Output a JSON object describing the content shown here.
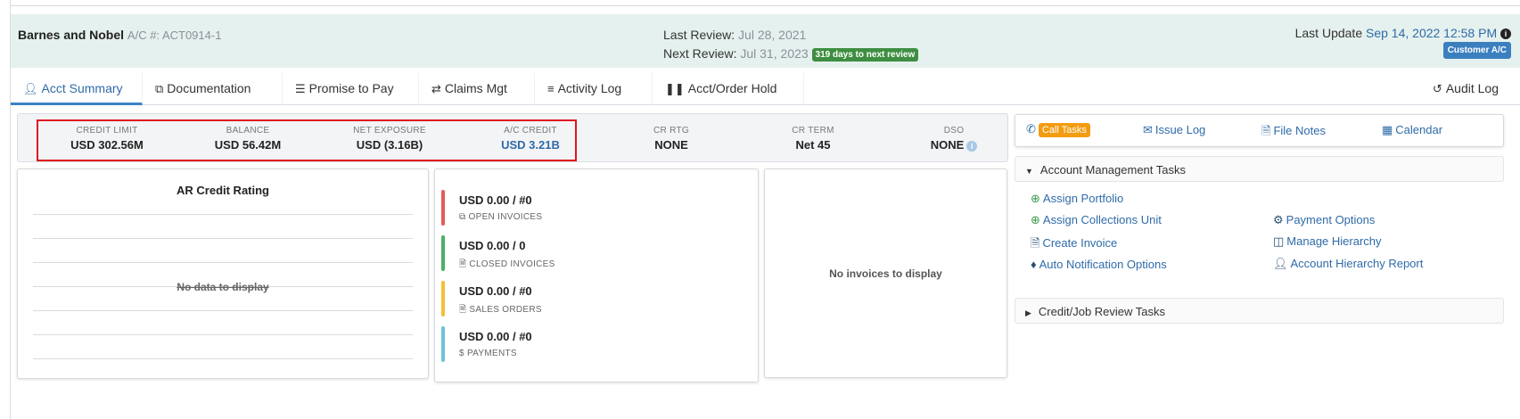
{
  "header": {
    "account_name": "Barnes and Nobel",
    "account_meta": "A/C #: ACT0914-1",
    "last_review_label": "Last Review:",
    "last_review_value": "Jul 28, 2021",
    "next_review_label": "Next Review:",
    "next_review_value": "Jul 31, 2023",
    "days_badge": "319 days to next review",
    "last_update_label": "Last Update",
    "last_update_value": "Sep 14, 2022 12:58 PM",
    "customer_badge": "Customer A/C"
  },
  "tabs": [
    {
      "label": "Acct Summary",
      "icon": "user-icon",
      "active": true
    },
    {
      "label": "Documentation",
      "icon": "copy-icon",
      "active": false
    },
    {
      "label": "Promise to Pay",
      "icon": "list-icon",
      "active": false
    },
    {
      "label": "Claims Mgt",
      "icon": "shuffle-icon",
      "active": false
    },
    {
      "label": "Activity Log",
      "icon": "checklist-icon",
      "active": false
    },
    {
      "label": "Acct/Order Hold",
      "icon": "pause-icon",
      "active": false
    }
  ],
  "audit_tab": {
    "label": "Audit Log",
    "icon": "history-icon"
  },
  "kpis": [
    {
      "label": "CREDIT LIMIT",
      "value": "USD 302.56M"
    },
    {
      "label": "BALANCE",
      "value": "USD 56.42M"
    },
    {
      "label": "NET EXPOSURE",
      "value": "USD (3.16B)"
    },
    {
      "label": "A/C CREDIT",
      "value": "USD 3.21B"
    },
    {
      "label": "CR RTG",
      "value": "NONE"
    },
    {
      "label": "CR TERM",
      "value": "Net 45"
    },
    {
      "label": "DSO",
      "value": "NONE"
    }
  ],
  "ar_panel": {
    "title": "AR Credit Rating",
    "empty": "No data to display"
  },
  "invoices": [
    {
      "amount": "USD 0.00 / #0",
      "label": "OPEN INVOICES",
      "color": "#e35d5b",
      "icon": "copy-icon"
    },
    {
      "amount": "USD 0.00 / 0",
      "label": "CLOSED INVOICES",
      "color": "#4caf67",
      "icon": "file-icon"
    },
    {
      "amount": "USD 0.00 / #0",
      "label": "SALES ORDERS",
      "color": "#f2c037",
      "icon": "file-icon"
    },
    {
      "amount": "USD 0.00 / #0",
      "label": "PAYMENTS",
      "color": "#6cc3d9",
      "icon": "dollar-icon"
    }
  ],
  "invoice_panel": {
    "empty": "No invoices to display"
  },
  "task_bar": {
    "call_tasks": "Call Tasks",
    "issue_log": "Issue Log",
    "file_notes": "File Notes",
    "calendar": "Calendar"
  },
  "account_tasks": {
    "title": "Account Management Tasks",
    "left": [
      "Assign Portfolio",
      "Assign Collections Unit",
      "Create Invoice",
      "Auto Notification Options"
    ],
    "right": [
      "Payment Options",
      "Manage Hierarchy",
      "Account Hierarchy Report"
    ]
  },
  "credit_tasks": {
    "title": "Credit/Job Review Tasks"
  }
}
